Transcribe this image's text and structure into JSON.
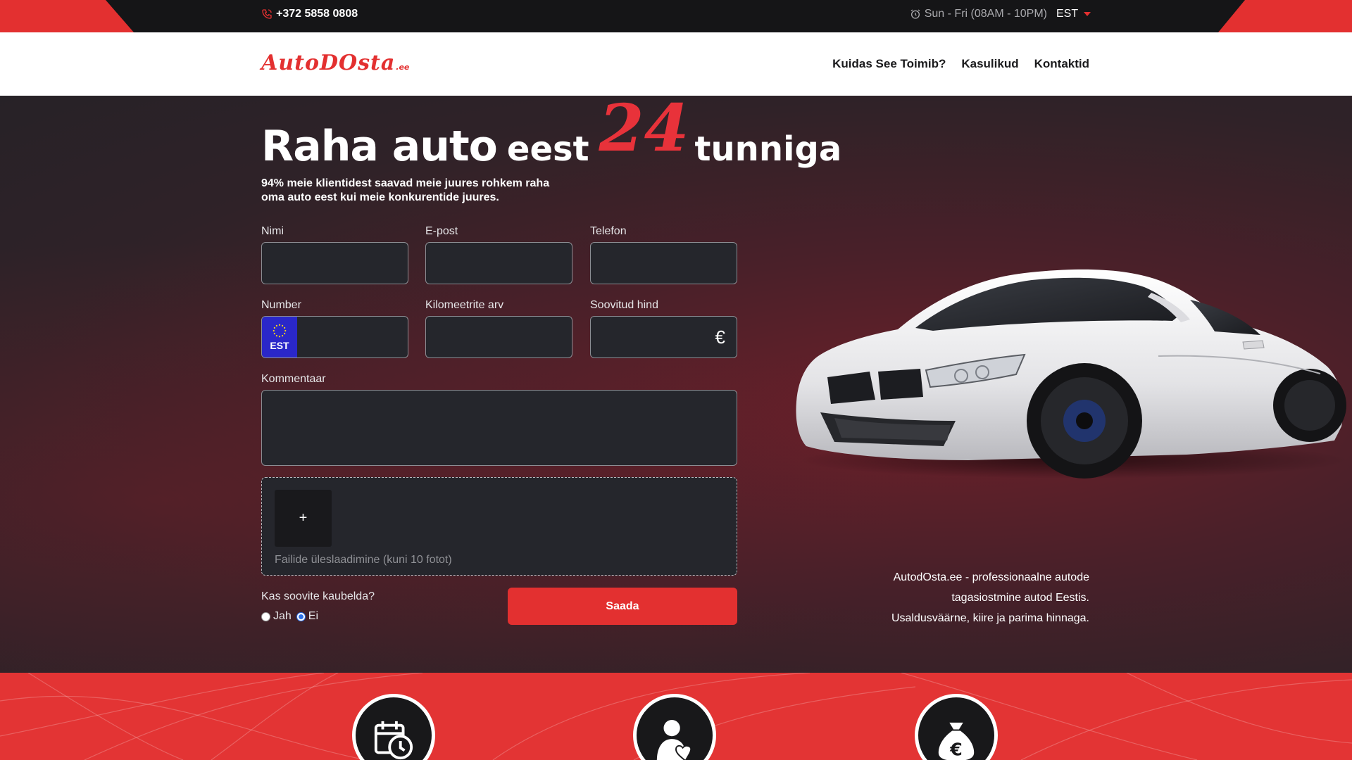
{
  "topbar": {
    "phone": "+372 5858 0808",
    "hours": "Sun - Fri (08AM - 10PM)",
    "language": "EST"
  },
  "header": {
    "logo_main": "AutoDOsta",
    "logo_tld": ".ee",
    "nav": [
      {
        "label": "Kuidas See Toimib?"
      },
      {
        "label": "Kasulikud"
      },
      {
        "label": "Kontaktid"
      }
    ]
  },
  "hero": {
    "title_part1": "Raha auto",
    "title_part2": "eest",
    "title_number": "24",
    "title_part3": "tunniga",
    "subtitle": "94% meie klientidest saavad meie juures rohkem raha oma auto eest kui meie konkurentide juures.",
    "form": {
      "name_label": "Nimi",
      "email_label": "E-post",
      "phone_label": "Telefon",
      "plate_label": "Number",
      "plate_country": "EST",
      "km_label": "Kilomeetrite arv",
      "price_label": "Soovitud hind",
      "currency_symbol": "€",
      "comment_label": "Kommentaar",
      "upload_plus": "+",
      "upload_hint": "Failide üleslaadimine (kuni 10 fotot)",
      "negotiate_question": "Kas soovite kaubelda?",
      "option_yes": "Jah",
      "option_no": "Ei",
      "selected_option": "Ei",
      "submit_label": "Saada"
    },
    "about_line1": "AutodOsta.ee - professionaalne autode",
    "about_line2": "tagasiostmine autod Eestis.",
    "about_line3": "Usaldusväärne, kiire ja parima hinnaga."
  },
  "features": [
    {
      "icon": "calendar-clock-icon"
    },
    {
      "icon": "person-heart-icon"
    },
    {
      "icon": "money-bag-euro-icon"
    }
  ],
  "colors": {
    "accent": "#e33030",
    "topbar_bg": "#151517",
    "field_bg": "#25262c",
    "plate_blue": "#2a27c9"
  }
}
